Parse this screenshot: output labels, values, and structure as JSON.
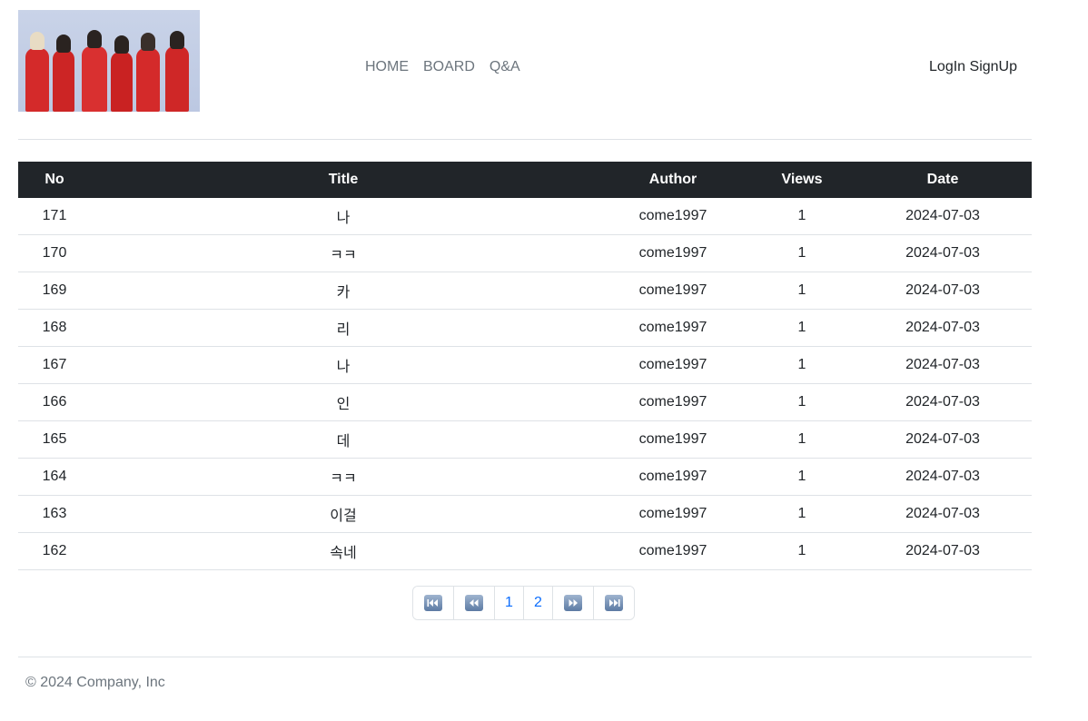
{
  "nav": {
    "items": [
      {
        "label": "HOME"
      },
      {
        "label": "BOARD"
      },
      {
        "label": "Q&A"
      }
    ]
  },
  "auth": {
    "login_label": "LogIn",
    "signup_label": "SignUp"
  },
  "table": {
    "headers": {
      "no": "No",
      "title": "Title",
      "author": "Author",
      "views": "Views",
      "date": "Date"
    },
    "rows": [
      {
        "no": "171",
        "title": "나",
        "author": "come1997",
        "views": "1",
        "date": "2024-07-03"
      },
      {
        "no": "170",
        "title": "ㅋㅋ",
        "author": "come1997",
        "views": "1",
        "date": "2024-07-03"
      },
      {
        "no": "169",
        "title": "카",
        "author": "come1997",
        "views": "1",
        "date": "2024-07-03"
      },
      {
        "no": "168",
        "title": "리",
        "author": "come1997",
        "views": "1",
        "date": "2024-07-03"
      },
      {
        "no": "167",
        "title": "나",
        "author": "come1997",
        "views": "1",
        "date": "2024-07-03"
      },
      {
        "no": "166",
        "title": "인",
        "author": "come1997",
        "views": "1",
        "date": "2024-07-03"
      },
      {
        "no": "165",
        "title": "데",
        "author": "come1997",
        "views": "1",
        "date": "2024-07-03"
      },
      {
        "no": "164",
        "title": "ㅋㅋ",
        "author": "come1997",
        "views": "1",
        "date": "2024-07-03"
      },
      {
        "no": "163",
        "title": "이걸",
        "author": "come1997",
        "views": "1",
        "date": "2024-07-03"
      },
      {
        "no": "162",
        "title": "속네",
        "author": "come1997",
        "views": "1",
        "date": "2024-07-03"
      }
    ]
  },
  "pagination": {
    "first_icon": "first-page-icon",
    "prev_icon": "previous-page-icon",
    "pages": [
      "1",
      "2"
    ],
    "next_icon": "next-page-icon",
    "last_icon": "last-page-icon"
  },
  "footer": {
    "copyright": "© 2024 Company, Inc"
  },
  "colors": {
    "header_bg": "#212529",
    "link": "#0d6efd",
    "muted": "#6c757d",
    "border": "#dee2e6"
  }
}
